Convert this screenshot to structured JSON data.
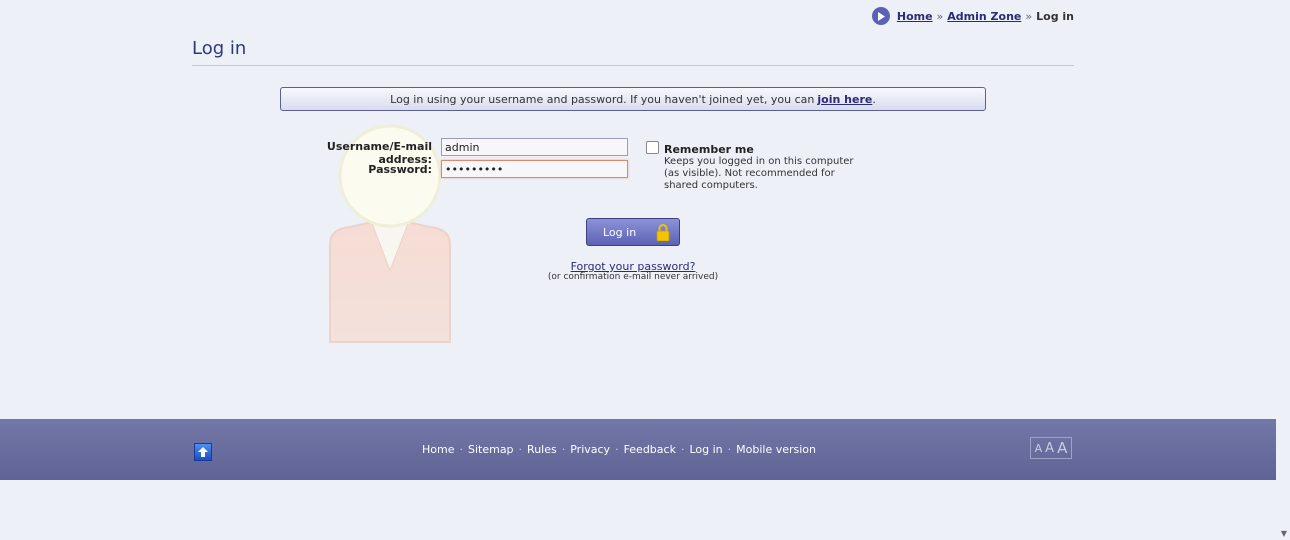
{
  "breadcrumb": {
    "items": [
      "Home",
      "Admin Zone"
    ],
    "separator": "»",
    "current": "Log in"
  },
  "page": {
    "title": "Log in"
  },
  "info": {
    "text": "Log in using your username and password. If you haven't joined yet, you can",
    "link": "join here",
    "suffix": "."
  },
  "form": {
    "username_label": "Username/E-mail address:",
    "username_value": "admin",
    "password_label": "Password:",
    "password_value": "•••••••••",
    "remember_label": "Remember me",
    "remember_hint": "Keeps you logged in on this computer (as visible). Not recommended for shared computers.",
    "login_button": "Log in",
    "forgot_link": "Forgot your password?",
    "forgot_note": "(or confirmation e-mail never arrived)"
  },
  "footer": {
    "links": [
      "Home",
      "Sitemap",
      "Rules",
      "Privacy",
      "Feedback",
      "Log in",
      "Mobile version"
    ],
    "separator": "·",
    "text_size": [
      "A",
      "A",
      "A"
    ]
  },
  "colors": {
    "accent": "#5c62b4",
    "footer": "#6a6e9f",
    "background": "#eef0f7"
  }
}
